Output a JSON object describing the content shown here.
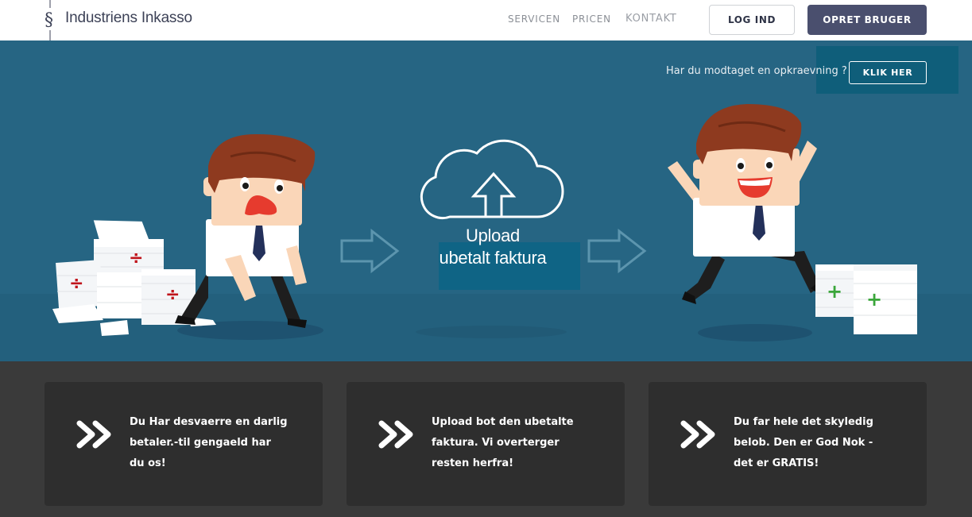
{
  "header": {
    "logo_text": "Industriens Inkasso",
    "nav": [
      "SERVICEN",
      "PRICEN",
      "KONTAKT"
    ],
    "login_label": "LOG IND",
    "signup_label": "OPRET BRUGER"
  },
  "hero": {
    "question": "Har du modtaget en opkraevning ?",
    "klik_label": "KLIK HER",
    "upload_line1": "Upload",
    "upload_line2": "ubetalt faktura"
  },
  "features": [
    {
      "icon": "double-chevron-right-icon",
      "text": "Du Har desvaerre en darlig betaler.-til gengaeld har du os!"
    },
    {
      "icon": "double-chevron-right-icon",
      "text": "Upload bot den ubetalte faktura. Vi overterger resten herfra!"
    },
    {
      "icon": "double-chevron-right-icon",
      "text": "Du far hele det skyledig belob. Den er God Nok - det er GRATIS!"
    }
  ],
  "colors": {
    "header_bg": "#ffffff",
    "hero_bg": "#266583",
    "brand": "#4a4f6e",
    "card_bg": "#2e2e2e",
    "divide_red": "#c0141b",
    "plus_green": "#3aa63a"
  }
}
